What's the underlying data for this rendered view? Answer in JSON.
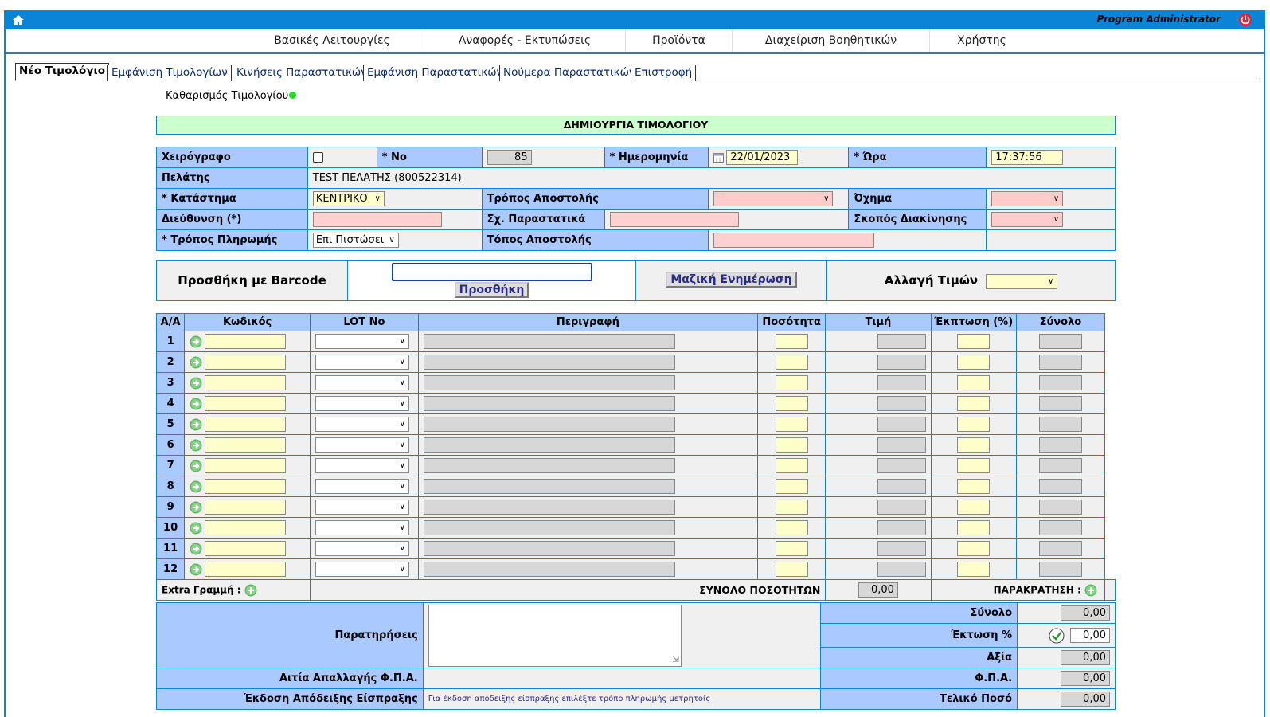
{
  "header": {
    "admin_label": "Program Administrator"
  },
  "menu": [
    {
      "label": "Βασικές Λειτουργίες"
    },
    {
      "label": "Αναφορές - Εκτυπώσεις"
    },
    {
      "label": "Προϊόντα"
    },
    {
      "label": "Διαχείριση Βοηθητικών"
    },
    {
      "label": "Χρήστης"
    }
  ],
  "tabs": [
    {
      "label": "Νέο Τιμολόγιο",
      "active": true
    },
    {
      "label": "Εμφάνιση Τιμολογίων"
    },
    {
      "label": "Κινήσεις Παραστατικών"
    },
    {
      "label": "Εμφάνιση Παραστατικών"
    },
    {
      "label": "Νούμερα Παραστατικών"
    },
    {
      "label": "Επιστροφή"
    }
  ],
  "clear_label": "Καθαρισμός Τιμολογίου",
  "form_title": "ΔΗΜΙΟΥΡΓΙΑ ΤΙΜΟΛΟΓΙΟΥ",
  "form": {
    "handwritten_label": "Χειρόγραφο",
    "no_label": "* Νο",
    "no_value": "85",
    "date_label": "* Ημερομηνία",
    "date_value": "22/01/2023",
    "time_label": "* Ώρα",
    "time_value": "17:37:56",
    "customer_label": "Πελάτης",
    "customer_value": "TEST ΠΕΛΑΤΗΣ (800522314)",
    "store_label": "* Κατάστημα",
    "store_value": "ΚΕΝΤΡΙΚΟ",
    "shipping_method_label": "Τρόπος Αποστολής",
    "vehicle_label": "Όχημα",
    "address_label": "Διεύθυνση (*)",
    "related_docs_label": "Σχ. Παραστατικά",
    "purpose_label": "Σκοπός Διακίνησης",
    "payment_label": "* Τρόπος Πληρωμής",
    "payment_value": "Επι Πιστώσει",
    "destination_label": "Τόπος Αποστολής"
  },
  "barcode": {
    "label": "Προσθήκη με Barcode",
    "add_button": "Προσθήκη",
    "mass_update_button": "Μαζική Ενημέρωση",
    "price_change_label": "Αλλαγή Τιμών"
  },
  "items": {
    "headers": [
      "Α/Α",
      "Κωδικός",
      "LOT No",
      "Περιγραφή",
      "Ποσότητα",
      "Τιμή",
      "Έκπτωση (%)",
      "Σύνολο"
    ],
    "rows": [
      "1",
      "2",
      "3",
      "4",
      "5",
      "6",
      "7",
      "8",
      "9",
      "10",
      "11",
      "12"
    ]
  },
  "footer": {
    "extra_line_label": "Extra Γραμμή :",
    "total_qty_label": "ΣΥΝΟΛΟ ΠΟΣΟΤΗΤΩΝ",
    "total_qty_value": "0,00",
    "withholding_label": "ΠΑΡΑΚΡΑΤΗΣΗ :",
    "notes_label": "Παρατηρήσεις",
    "total_label": "Σύνολο",
    "total_value": "0,00",
    "discount_label": "Έκτωση %",
    "discount_value": "0,00",
    "value_label": "Αξία",
    "value_value": "0,00",
    "vat_label": "Φ.Π.Α.",
    "vat_value": "0,00",
    "final_label": "Τελικό Ποσό",
    "final_value": "0,00",
    "vat_exempt_label": "Αιτία Απαλλαγής Φ.Π.Α.",
    "receipt_label": "Έκδοση Απόδειξης Είσπραξης",
    "receipt_note": "Για έκδοση απόδειξης είσπραξης επιλέξτε τρόπο πληρωμής μετρητοίς"
  }
}
